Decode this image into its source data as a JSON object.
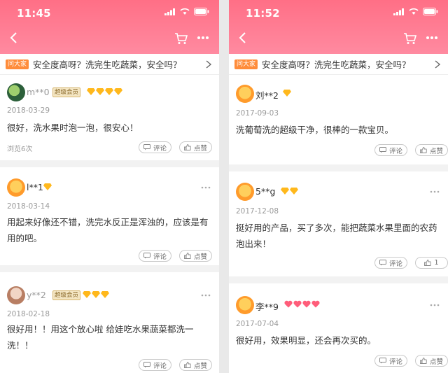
{
  "left": {
    "time": "11:45",
    "question_tag": "问大家",
    "question_text": "安全度高呀？洗完生吃蔬菜，安全吗？",
    "reviews": [
      {
        "user": "m**0",
        "badge": "超级会员",
        "gems": 4,
        "date": "2018-03-29",
        "content": "很好，洗水果时泡一泡，很安心！",
        "views": "浏览6次",
        "comment": "评论",
        "like": "点赞"
      },
      {
        "user": "l**1",
        "badge": "",
        "gems": 1,
        "date": "2018-03-14",
        "content": "用起来好像还不错，洗完水反正是浑浊的，应该是有用的吧。",
        "comment": "评论",
        "like": "点赞"
      },
      {
        "user": "y**2",
        "badge": "超级会员",
        "gems": 3,
        "date": "2018-02-18",
        "content": "很好用！！用这个放心啦 给娃吃水果蔬菜都洗一洗！！",
        "comment": "评论",
        "like": "点赞"
      }
    ]
  },
  "right": {
    "time": "11:52",
    "question_tag": "问大家",
    "question_text": "安全度高呀？洗完生吃蔬菜，安全吗？",
    "reviews": [
      {
        "user": "刘**2",
        "gems": 1,
        "date": "2017-09-03",
        "content": "洗葡萄洗的超级干净，很棒的一款宝贝。",
        "comment": "评论",
        "like": "点赞"
      },
      {
        "user": "5**g",
        "gems": 2,
        "date": "2017-12-08",
        "content": "挺好用的产品，买了多次，能把蔬菜水果里面的农药泡出来！",
        "comment": "评论",
        "like": "1"
      },
      {
        "user": "李**9",
        "hearts": 4,
        "date": "2017-07-04",
        "content": "很好用，效果明显，还会再次买的。",
        "comment": "评论",
        "like": "点赞"
      }
    ]
  },
  "colors": {
    "header": "#ff7a92",
    "gem": "#ffb81c",
    "heart": "#ff5d7a",
    "tag": "#ff8c3a"
  }
}
